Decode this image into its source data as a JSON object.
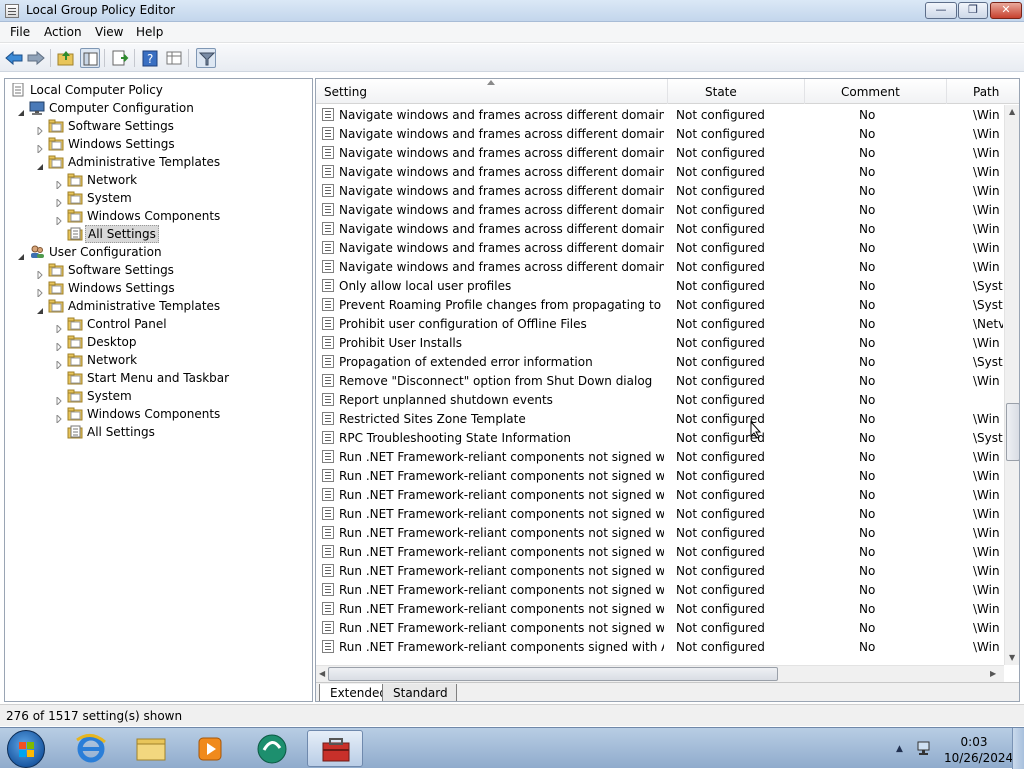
{
  "window": {
    "title": "Local Group Policy Editor",
    "minimize": "—",
    "maximize": "❐",
    "close": "✕"
  },
  "menu": [
    "File",
    "Action",
    "View",
    "Help"
  ],
  "tree": [
    {
      "label": "Local Computer Policy",
      "level": 0,
      "expander": "none",
      "icon": "policy-icon"
    },
    {
      "label": "Computer Configuration",
      "level": 1,
      "expander": "open",
      "icon": "computer-icon"
    },
    {
      "label": "Software Settings",
      "level": 2,
      "expander": "closed",
      "icon": "folder-icon"
    },
    {
      "label": "Windows Settings",
      "level": 2,
      "expander": "closed",
      "icon": "folder-icon"
    },
    {
      "label": "Administrative Templates",
      "level": 2,
      "expander": "open",
      "icon": "folder-icon"
    },
    {
      "label": "Network",
      "level": 3,
      "expander": "closed",
      "icon": "folder-icon"
    },
    {
      "label": "System",
      "level": 3,
      "expander": "closed",
      "icon": "folder-icon"
    },
    {
      "label": "Windows Components",
      "level": 3,
      "expander": "closed",
      "icon": "folder-icon"
    },
    {
      "label": "All Settings",
      "level": 3,
      "expander": "none",
      "icon": "all-settings-icon",
      "selected": true
    },
    {
      "label": "User Configuration",
      "level": 1,
      "expander": "open",
      "icon": "users-icon"
    },
    {
      "label": "Software Settings",
      "level": 2,
      "expander": "closed",
      "icon": "folder-icon"
    },
    {
      "label": "Windows Settings",
      "level": 2,
      "expander": "closed",
      "icon": "folder-icon"
    },
    {
      "label": "Administrative Templates",
      "level": 2,
      "expander": "open",
      "icon": "folder-icon"
    },
    {
      "label": "Control Panel",
      "level": 3,
      "expander": "closed",
      "icon": "folder-icon"
    },
    {
      "label": "Desktop",
      "level": 3,
      "expander": "closed",
      "icon": "folder-icon"
    },
    {
      "label": "Network",
      "level": 3,
      "expander": "closed",
      "icon": "folder-icon"
    },
    {
      "label": "Start Menu and Taskbar",
      "level": 3,
      "expander": "none",
      "icon": "folder-icon"
    },
    {
      "label": "System",
      "level": 3,
      "expander": "closed",
      "icon": "folder-icon"
    },
    {
      "label": "Windows Components",
      "level": 3,
      "expander": "closed",
      "icon": "folder-icon"
    },
    {
      "label": "All Settings",
      "level": 3,
      "expander": "none",
      "icon": "all-settings-icon"
    }
  ],
  "columns": {
    "setting": "Setting",
    "state": "State",
    "comment": "Comment",
    "path": "Path"
  },
  "rows": [
    {
      "setting": "Navigate windows and frames across different domains",
      "state": "Not configured",
      "comment": "No",
      "path": "\\Win"
    },
    {
      "setting": "Navigate windows and frames across different domains",
      "state": "Not configured",
      "comment": "No",
      "path": "\\Win"
    },
    {
      "setting": "Navigate windows and frames across different domains",
      "state": "Not configured",
      "comment": "No",
      "path": "\\Win"
    },
    {
      "setting": "Navigate windows and frames across different domains",
      "state": "Not configured",
      "comment": "No",
      "path": "\\Win"
    },
    {
      "setting": "Navigate windows and frames across different domains",
      "state": "Not configured",
      "comment": "No",
      "path": "\\Win"
    },
    {
      "setting": "Navigate windows and frames across different domains",
      "state": "Not configured",
      "comment": "No",
      "path": "\\Win"
    },
    {
      "setting": "Navigate windows and frames across different domains",
      "state": "Not configured",
      "comment": "No",
      "path": "\\Win"
    },
    {
      "setting": "Navigate windows and frames across different domains",
      "state": "Not configured",
      "comment": "No",
      "path": "\\Win"
    },
    {
      "setting": "Navigate windows and frames across different domains",
      "state": "Not configured",
      "comment": "No",
      "path": "\\Win"
    },
    {
      "setting": "Only allow local user profiles",
      "state": "Not configured",
      "comment": "No",
      "path": "\\Syst"
    },
    {
      "setting": "Prevent Roaming Profile changes from propagating to the s...",
      "state": "Not configured",
      "comment": "No",
      "path": "\\Syst"
    },
    {
      "setting": "Prohibit user configuration of Offline Files",
      "state": "Not configured",
      "comment": "No",
      "path": "\\Netv"
    },
    {
      "setting": "Prohibit User Installs",
      "state": "Not configured",
      "comment": "No",
      "path": "\\Win"
    },
    {
      "setting": "Propagation of extended error information",
      "state": "Not configured",
      "comment": "No",
      "path": "\\Syst"
    },
    {
      "setting": "Remove \"Disconnect\" option from Shut Down dialog",
      "state": "Not configured",
      "comment": "No",
      "path": "\\Win"
    },
    {
      "setting": "Report unplanned shutdown events",
      "state": "Not configured",
      "comment": "No",
      "path": ""
    },
    {
      "setting": "Restricted Sites Zone Template",
      "state": "Not configured",
      "comment": "No",
      "path": "\\Win"
    },
    {
      "setting": "RPC Troubleshooting State Information",
      "state": "Not configured",
      "comment": "No",
      "path": "\\Syst"
    },
    {
      "setting": "Run .NET Framework-reliant components not signed with A...",
      "state": "Not configured",
      "comment": "No",
      "path": "\\Win"
    },
    {
      "setting": "Run .NET Framework-reliant components not signed with A...",
      "state": "Not configured",
      "comment": "No",
      "path": "\\Win"
    },
    {
      "setting": "Run .NET Framework-reliant components not signed with A...",
      "state": "Not configured",
      "comment": "No",
      "path": "\\Win"
    },
    {
      "setting": "Run .NET Framework-reliant components not signed with A...",
      "state": "Not configured",
      "comment": "No",
      "path": "\\Win"
    },
    {
      "setting": "Run .NET Framework-reliant components not signed with A...",
      "state": "Not configured",
      "comment": "No",
      "path": "\\Win"
    },
    {
      "setting": "Run .NET Framework-reliant components not signed with A...",
      "state": "Not configured",
      "comment": "No",
      "path": "\\Win"
    },
    {
      "setting": "Run .NET Framework-reliant components not signed with A...",
      "state": "Not configured",
      "comment": "No",
      "path": "\\Win"
    },
    {
      "setting": "Run .NET Framework-reliant components not signed with A...",
      "state": "Not configured",
      "comment": "No",
      "path": "\\Win"
    },
    {
      "setting": "Run .NET Framework-reliant components not signed with A...",
      "state": "Not configured",
      "comment": "No",
      "path": "\\Win"
    },
    {
      "setting": "Run .NET Framework-reliant components not signed with A...",
      "state": "Not configured",
      "comment": "No",
      "path": "\\Win"
    },
    {
      "setting": "Run .NET Framework-reliant components signed with Auth...",
      "state": "Not configured",
      "comment": "No",
      "path": "\\Win"
    }
  ],
  "tabs": {
    "extended": "Extended",
    "standard": "Standard"
  },
  "status": "276 of 1517 setting(s) shown",
  "taskbar": {
    "time": "0:03",
    "date": "10/26/2024",
    "tray_arrow": "▲"
  },
  "colors": {
    "folder": "#e8c55a",
    "selection": "#d9d9d9",
    "taskbar": "#a5bedc"
  }
}
